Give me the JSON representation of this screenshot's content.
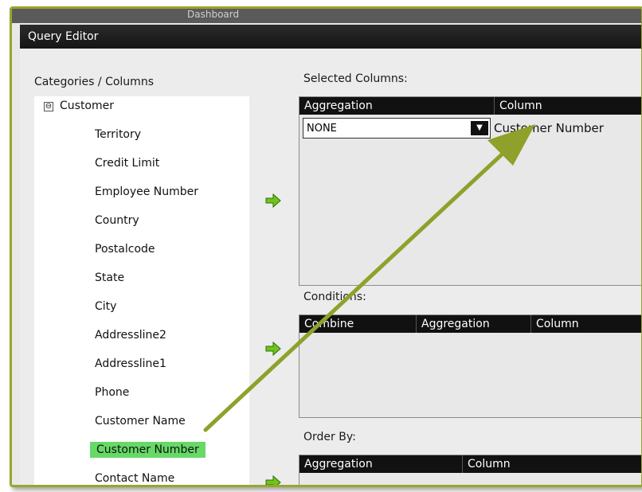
{
  "background_app": {
    "title_fragment": "Dashboard"
  },
  "dialog": {
    "title": "Query Editor"
  },
  "categories": {
    "label": "Categories / Columns",
    "root": {
      "expander": "⊖",
      "label": "Customer"
    },
    "items": [
      "Territory",
      "Credit Limit",
      "Employee Number",
      "Country",
      "Postalcode",
      "State",
      "City",
      "Addressline2",
      "Addressline1",
      "Phone",
      "Customer Name",
      "Customer Number",
      "Contact Name"
    ],
    "selected_item": "Customer Number"
  },
  "selected_columns": {
    "label": "Selected Columns:",
    "headers": [
      "Aggregation",
      "Column"
    ],
    "row": {
      "aggregation": "NONE",
      "column": "Customer Number"
    }
  },
  "conditions": {
    "label": "Conditions:",
    "headers": [
      "Combine",
      "Aggregation",
      "Column"
    ]
  },
  "order_by": {
    "label": "Order By:",
    "headers": [
      "Aggregation",
      "Column"
    ]
  },
  "icons": {
    "add": "green-right-arrow-icon",
    "dropdown": "down-triangle-icon"
  },
  "colors": {
    "selection": "#66d966",
    "annotation_arrow": "#8fa12a",
    "header": "#111111"
  }
}
